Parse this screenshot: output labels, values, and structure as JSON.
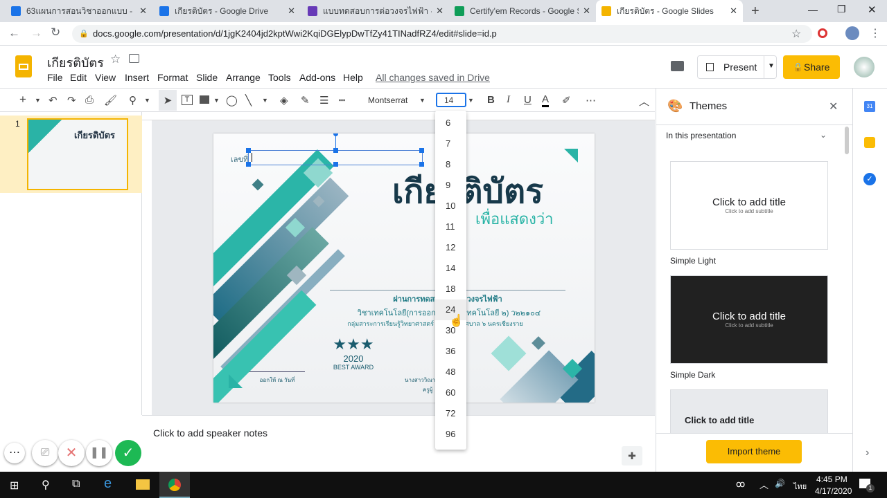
{
  "browser": {
    "tabs": [
      {
        "title": "63แผนการสอนวิชาออกแบบ - Goo",
        "icon": "google-drive-icon",
        "color": "#1a73e8"
      },
      {
        "title": "เกียรติบัตร - Google Drive",
        "icon": "google-drive-icon",
        "color": "#1a73e8"
      },
      {
        "title": "แบบทดสอบการต่อวงจรไฟฟ้า - Goo",
        "icon": "google-forms-icon",
        "color": "#673ab7"
      },
      {
        "title": "Certify'em Records - Google Sh",
        "icon": "google-sheets-icon",
        "color": "#0f9d58"
      },
      {
        "title": "เกียรติบัตร - Google Slides",
        "icon": "google-slides-icon",
        "color": "#f4b400",
        "active": true
      }
    ],
    "url": "docs.google.com/presentation/d/1jgK2404jd2kptWwi2KqiDGElypDwTfZy41TINadfRZ4/edit#slide=id.p"
  },
  "app": {
    "doc_title": "เกียรติบัตร",
    "menu": [
      "File",
      "Edit",
      "View",
      "Insert",
      "Format",
      "Slide",
      "Arrange",
      "Tools",
      "Add-ons",
      "Help"
    ],
    "save_status": "All changes saved in Drive",
    "present_label": "Present",
    "share_label": "Share",
    "accent": "#fbbc04"
  },
  "toolbar": {
    "font": "Montserrat",
    "font_size": "14"
  },
  "font_size_options": [
    "6",
    "7",
    "8",
    "9",
    "10",
    "11",
    "12",
    "14",
    "18",
    "24",
    "30",
    "36",
    "48",
    "60",
    "72",
    "96"
  ],
  "hovered_size": "24",
  "filmstrip": {
    "slide_number": "1"
  },
  "slide": {
    "label": "เลขที่",
    "title": "เกียรติบัตร",
    "subtitle": "เพื่อแสดงว่า",
    "line1": "ผ่านการทดสอบการต่อวงจรไฟฟ้า",
    "line2": "วิชาเทคโนโลยี(การออกแบบและเทคโนโลยี ๒) ว๒๒๑๐๔",
    "line3": "กลุ่มสาระการเรียนรู้วิทยาศาสตร์ โรงเรียนเทศบาล ๖ นครเชียงราย",
    "award_year": "2020",
    "award_text": "BEST AWARD",
    "issued": "ออกให้ ณ วันที่",
    "signer": "นางสาววิณา",
    "signer_role": "ครูผู้"
  },
  "notes_placeholder": "Click to add speaker notes",
  "themes": {
    "title": "Themes",
    "section": "In this presentation",
    "items": [
      {
        "name": "Simple Light",
        "title": "Click to add title",
        "subtitle": "Click to add subtitle"
      },
      {
        "name": "Simple Dark",
        "title": "Click to add title",
        "subtitle": "Click to add subtitle"
      },
      {
        "name": "",
        "title": "Click to add title"
      }
    ],
    "import_label": "Import theme"
  },
  "taskbar": {
    "time": "4:45 PM",
    "date": "4/17/2020",
    "lang": "ไทย",
    "notifications": "1"
  }
}
